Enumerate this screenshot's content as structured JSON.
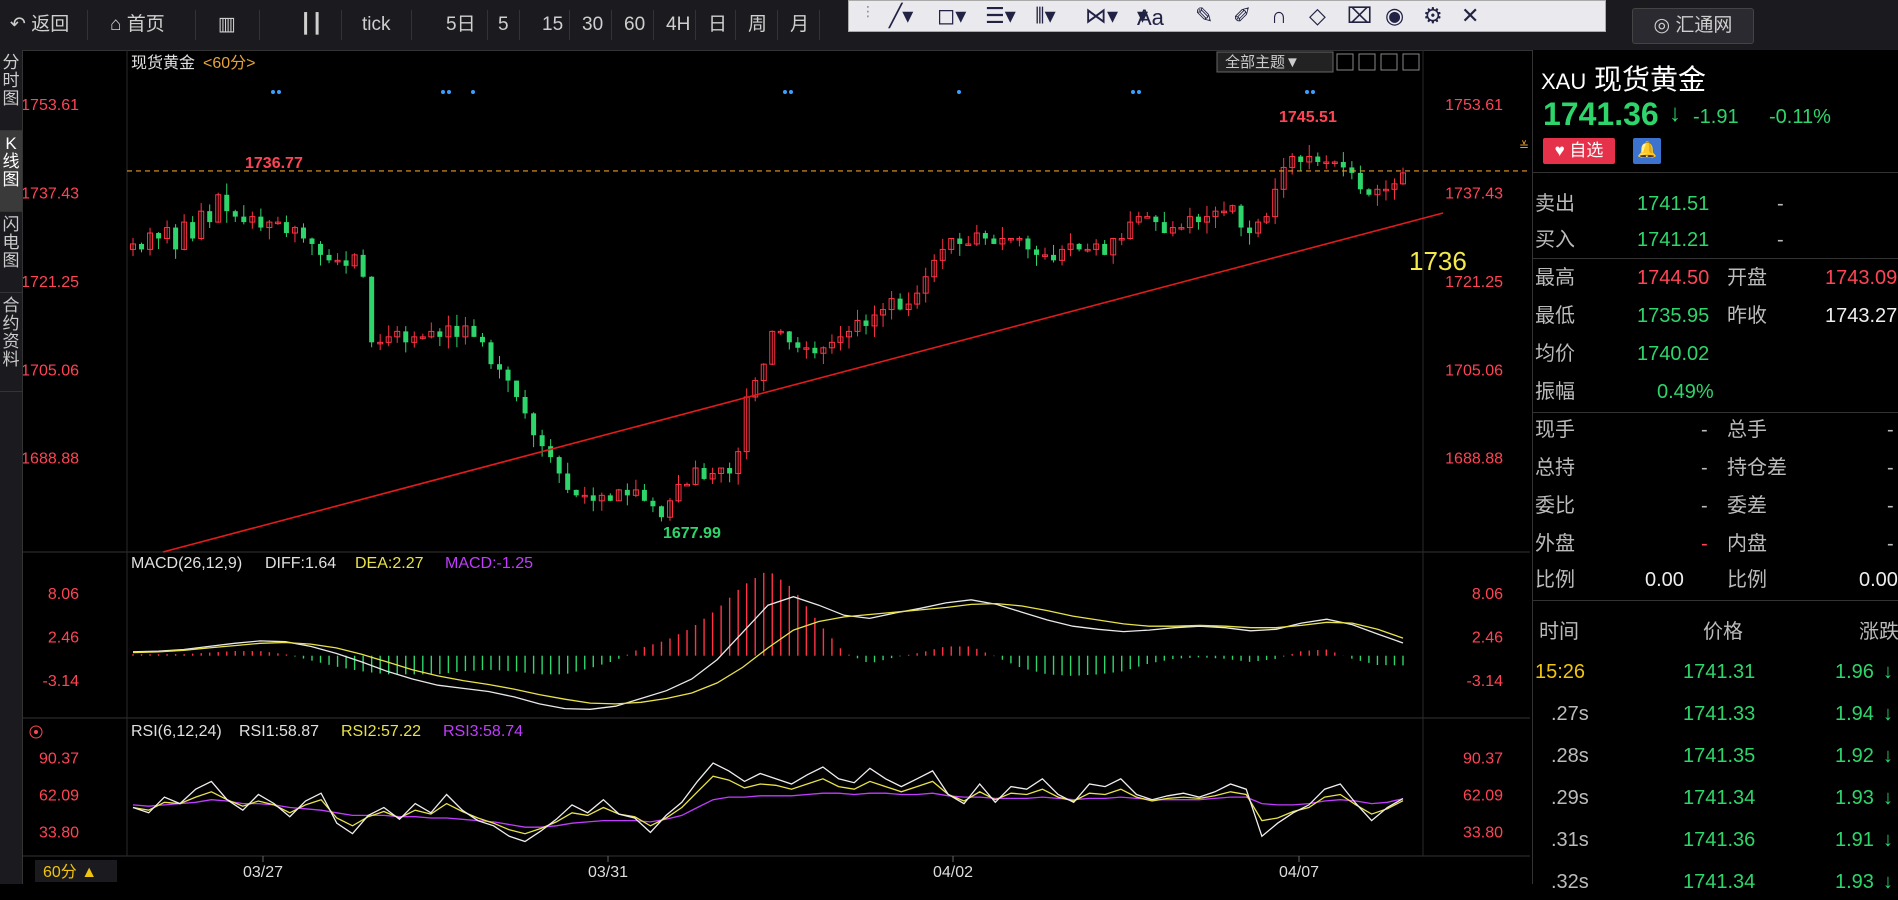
{
  "toolbar": {
    "buttons": [
      "返回",
      "首页",
      "tick",
      "5日",
      "5",
      "15",
      "30",
      "60",
      "4H",
      "日",
      "周",
      "月"
    ],
    "draw_icons": [
      "line-tool-icon",
      "shape-tool-icon",
      "fib-tool-icon",
      "channel-tool-icon",
      "pattern-tool-icon",
      "text-tool-icon",
      "ruler-icon",
      "pen-icon",
      "magnet-icon",
      "eraser-icon",
      "trash-icon",
      "eye-icon",
      "gear-icon",
      "close-icon"
    ],
    "text_tool": "Aa",
    "close": "✕",
    "huitong": "汇通网"
  },
  "left_tabs": [
    "分时图",
    "K线图",
    "闪电图",
    "合约资料"
  ],
  "chart": {
    "symbol_label": "现货黄金",
    "period_tag": "<60分>",
    "theme_button": "全部主题▼",
    "annotation_price": "1736",
    "high_marker": "1745.51",
    "prev_high_marker": "1736.77",
    "low_marker": "1677.99",
    "macd_label": "MACD(26,12,9)",
    "macd_diff": "DIFF:1.64",
    "macd_dea": "DEA:2.27",
    "macd_val": "MACD:-1.25",
    "rsi_label": "RSI(6,12,24)",
    "rsi1": "RSI1:58.87",
    "rsi2": "RSI2:57.22",
    "rsi3": "RSI3:58.74",
    "period_button": "60分 ▲",
    "colors": {
      "up": "#ff3344",
      "down": "#2dd56b",
      "trend": "#e21b1b",
      "ma_yellow": "#e8e24a",
      "rsi3": "#c13cff"
    }
  },
  "chart_data": [
    {
      "type": "candlestick",
      "title": "现货黄金 <60分>",
      "ylim": [
        1672,
        1758
      ],
      "y_ticks": [
        1753.61,
        1737.43,
        1721.25,
        1705.06,
        1688.88
      ],
      "x_ticks": [
        "03/27",
        "03/31",
        "04/02",
        "04/07"
      ],
      "close": [
        1728,
        1727,
        1730,
        1729,
        1731,
        1727,
        1732,
        1729,
        1734,
        1732,
        1737,
        1734,
        1733,
        1732,
        1733,
        1731,
        1732,
        1732,
        1730,
        1731,
        1729,
        1728,
        1726,
        1725,
        1725,
        1724,
        1726,
        1722,
        1710,
        1710,
        1711,
        1712,
        1710,
        1711,
        1711,
        1712,
        1711,
        1713,
        1711,
        1713,
        1711,
        1710,
        1706,
        1705,
        1703,
        1700,
        1697,
        1693,
        1691,
        1689,
        1686,
        1683,
        1682,
        1682,
        1681,
        1682,
        1681,
        1683,
        1682,
        1683,
        1681,
        1680,
        1678,
        1681,
        1684,
        1684,
        1687,
        1685,
        1686,
        1687,
        1686,
        1690,
        1700,
        1703,
        1706,
        1712,
        1712,
        1710,
        1709,
        1709,
        1708,
        1709,
        1710,
        1711,
        1712,
        1714,
        1713,
        1715,
        1716,
        1718,
        1716,
        1717,
        1719,
        1722,
        1725,
        1727,
        1729,
        1728,
        1728,
        1730,
        1729,
        1728,
        1729,
        1729,
        1729,
        1727,
        1726,
        1726,
        1725,
        1727,
        1728,
        1727,
        1727,
        1728,
        1726,
        1729,
        1729,
        1732,
        1733,
        1733,
        1732,
        1730,
        1731,
        1731,
        1733,
        1732,
        1733,
        1734,
        1734,
        1735,
        1731,
        1730,
        1732,
        1733,
        1738,
        1742,
        1744,
        1743,
        1744,
        1743,
        1743,
        1743,
        1742,
        1741,
        1738,
        1737,
        1738,
        1738,
        1739,
        1741
      ],
      "high": 1745.51,
      "low": 1677.99,
      "annotations": [
        "1745.51",
        "1736.77",
        "1677.99",
        "1736"
      ],
      "dashed_level": 1741.36
    },
    {
      "type": "line",
      "title": "MACD(26,12,9)",
      "y_ticks": [
        8.06,
        2.46,
        -3.14
      ],
      "ylim": [
        -7.5,
        10.0
      ],
      "series": [
        {
          "name": "DIFF",
          "values": [
            0.5,
            0.6,
            0.8,
            1.2,
            1.6,
            1.9,
            1.8,
            1.2,
            0.3,
            -0.8,
            -2.0,
            -3.0,
            -3.8,
            -4.2,
            -4.6,
            -5.3,
            -6.2,
            -6.8,
            -6.9,
            -6.5,
            -5.5,
            -4.5,
            -3.0,
            -0.5,
            3.0,
            6.5,
            7.6,
            6.5,
            5.2,
            4.8,
            5.5,
            6.1,
            6.8,
            7.2,
            6.6,
            5.6,
            4.6,
            3.8,
            3.4,
            3.1,
            3.3,
            3.6,
            3.8,
            3.6,
            3.2,
            3.4,
            4.2,
            4.7,
            4.0,
            2.8,
            1.64
          ]
        },
        {
          "name": "DEA",
          "values": [
            0.4,
            0.5,
            0.7,
            1.0,
            1.3,
            1.6,
            1.7,
            1.5,
            1.0,
            0.2,
            -0.8,
            -1.8,
            -2.6,
            -3.2,
            -3.7,
            -4.3,
            -5.0,
            -5.6,
            -6.1,
            -6.2,
            -6.0,
            -5.5,
            -4.8,
            -3.5,
            -1.5,
            1.0,
            3.3,
            4.4,
            5.0,
            5.3,
            5.6,
            5.9,
            6.2,
            6.6,
            6.7,
            6.4,
            5.8,
            5.1,
            4.6,
            4.1,
            3.8,
            3.8,
            3.9,
            3.8,
            3.6,
            3.6,
            3.9,
            4.3,
            4.2,
            3.4,
            2.27
          ]
        },
        {
          "name": "MACD",
          "values": [
            0.2,
            0.2,
            0.2,
            0.4,
            0.6,
            0.6,
            0.2,
            -0.6,
            -1.4,
            -2.0,
            -2.4,
            -2.4,
            -2.4,
            -2.0,
            -1.8,
            -2.0,
            -2.4,
            -2.4,
            -1.6,
            -0.6,
            1.0,
            2.0,
            3.6,
            6.0,
            9.0,
            11.0,
            8.6,
            4.2,
            0.4,
            -1.0,
            -0.2,
            0.4,
            1.2,
            1.2,
            -0.2,
            -1.6,
            -2.4,
            -2.6,
            -2.4,
            -2.0,
            -1.0,
            -0.4,
            -0.2,
            -0.4,
            -0.8,
            -0.4,
            0.6,
            0.8,
            -0.4,
            -1.2,
            -1.25
          ]
        }
      ]
    },
    {
      "type": "line",
      "title": "RSI(6,12,24)",
      "y_ticks": [
        90.37,
        62.09,
        33.8
      ],
      "ylim": [
        18,
        96
      ],
      "series": [
        {
          "name": "RSI1",
          "values": [
            52,
            48,
            60,
            55,
            66,
            72,
            58,
            50,
            62,
            55,
            45,
            57,
            63,
            40,
            32,
            46,
            52,
            43,
            55,
            48,
            62,
            50,
            42,
            38,
            30,
            26,
            34,
            43,
            54,
            48,
            58,
            47,
            44,
            33,
            46,
            56,
            72,
            86,
            80,
            72,
            78,
            74,
            70,
            77,
            83,
            74,
            71,
            82,
            74,
            68,
            74,
            80,
            62,
            55,
            70,
            56,
            68,
            66,
            74,
            62,
            56,
            70,
            68,
            74,
            62,
            58,
            61,
            63,
            60,
            64,
            70,
            66,
            30,
            40,
            48,
            54,
            66,
            70,
            55,
            42,
            52,
            58.87
          ]
        },
        {
          "name": "RSI2",
          "values": [
            52,
            50,
            56,
            55,
            60,
            64,
            58,
            53,
            57,
            54,
            48,
            54,
            58,
            44,
            38,
            45,
            49,
            44,
            50,
            47,
            55,
            49,
            44,
            40,
            35,
            32,
            36,
            41,
            48,
            46,
            52,
            47,
            45,
            38,
            44,
            52,
            64,
            76,
            73,
            67,
            70,
            69,
            66,
            70,
            74,
            68,
            66,
            72,
            68,
            64,
            68,
            72,
            62,
            57,
            64,
            58,
            63,
            62,
            66,
            60,
            57,
            63,
            62,
            66,
            60,
            57,
            59,
            60,
            59,
            61,
            64,
            62,
            42,
            44,
            49,
            52,
            60,
            62,
            54,
            47,
            51,
            57.22
          ]
        },
        {
          "name": "RSI3",
          "values": [
            54,
            53,
            54,
            55,
            56,
            58,
            57,
            55,
            55,
            54,
            52,
            51,
            50,
            48,
            46,
            46,
            46,
            45,
            45,
            44,
            44,
            43,
            42,
            41,
            39,
            37,
            37,
            38,
            40,
            41,
            42,
            42,
            42,
            41,
            43,
            46,
            52,
            58,
            60,
            60,
            61,
            61,
            61,
            62,
            63,
            63,
            62,
            63,
            63,
            62,
            62,
            63,
            61,
            60,
            60,
            59,
            59,
            59,
            60,
            59,
            58,
            59,
            59,
            60,
            59,
            58,
            58,
            58,
            58,
            59,
            60,
            60,
            55,
            54,
            54,
            55,
            57,
            58,
            57,
            55,
            56,
            58.74
          ]
        }
      ]
    }
  ],
  "quote": {
    "symbol": "XAU",
    "name": "现货黄金",
    "price": "1741.36",
    "arrow": "↓",
    "change": "-1.91",
    "pct": "-0.11%",
    "zixuan": "♥ 自选",
    "bell": "🔔",
    "ask_label": "卖出",
    "ask": "1741.51",
    "ask_dash": "-",
    "bid_label": "买入",
    "bid": "1741.21",
    "bid_dash": "-",
    "high_label": "最高",
    "high": "1744.50",
    "open_label": "开盘",
    "open": "1743.09",
    "low_label": "最低",
    "low": "1735.95",
    "prev_label": "昨收",
    "prev": "1743.27",
    "avg_label": "均价",
    "avg": "1740.02",
    "amp_label": "振幅",
    "amp": "0.49%",
    "now_label": "现手",
    "now": "-",
    "total_label": "总手",
    "total": "-",
    "hold_label": "总持",
    "hold": "-",
    "holddiff_label": "持仓差",
    "holddiff": "-",
    "wb_label": "委比",
    "wb": "-",
    "wc_label": "委差",
    "wc": "-",
    "out_label": "外盘",
    "out": "-",
    "in_label": "内盘",
    "in": "-",
    "ratio_label": "比例",
    "ratio": "0.00",
    "ratio2_label": "比例",
    "ratio2": "0.00"
  },
  "ticks_table": {
    "headers": [
      "时间",
      "价格",
      "涨跌"
    ],
    "rows": [
      {
        "time": "15:26",
        "price": "1741.31",
        "chg": "1.96"
      },
      {
        "time": ".27s",
        "price": "1741.33",
        "chg": "1.94"
      },
      {
        "time": ".28s",
        "price": "1741.35",
        "chg": "1.92"
      },
      {
        "time": ".29s",
        "price": "1741.34",
        "chg": "1.93"
      },
      {
        "time": ".31s",
        "price": "1741.36",
        "chg": "1.91"
      },
      {
        "time": ".32s",
        "price": "1741.34",
        "chg": "1.93"
      }
    ]
  }
}
